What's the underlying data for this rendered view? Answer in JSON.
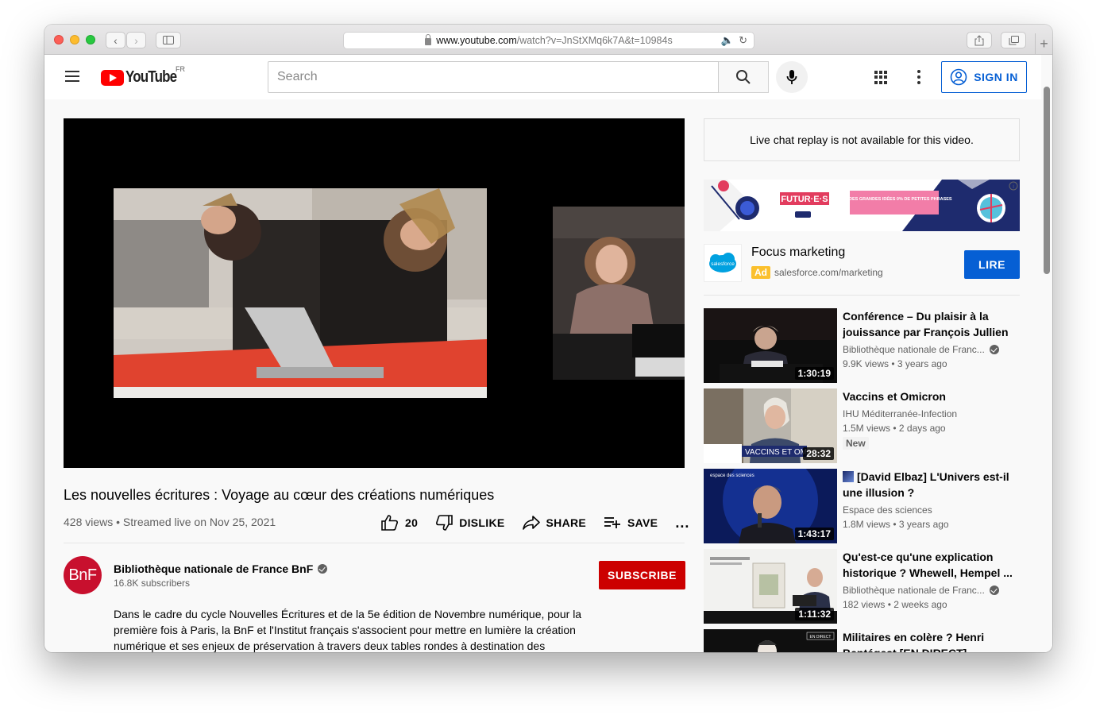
{
  "browser": {
    "url_host": "www.youtube.com",
    "url_path": "/watch?v=JnStXMq6k7A&t=10984s"
  },
  "header": {
    "logo_text": "YouTube",
    "region": "FR",
    "search_placeholder": "Search",
    "signin_label": "SIGN IN"
  },
  "video": {
    "title": "Les nouvelles écritures : Voyage au cœur des créations numériques",
    "meta": "428 views • Streamed live on Nov 25, 2021",
    "likes": "20",
    "dislike_label": "DISLIKE",
    "share_label": "SHARE",
    "save_label": "SAVE",
    "more_label": "..."
  },
  "channel": {
    "avatar_text": "BnF",
    "name": "Bibliothèque nationale de France BnF",
    "subscribers": "16.8K subscribers",
    "subscribe_label": "SUBSCRIBE",
    "description": "Dans le cadre du cycle Nouvelles Écritures et de la 5e édition de Novembre numérique, pour la première fois à Paris, la BnF et l'Institut français s'associent pour mettre en lumière la création numérique et ses enjeux de préservation à travers deux tables rondes à destination des"
  },
  "sidebar": {
    "chat_message": "Live chat replay is not available for this video.",
    "banner": {
      "brand": "FUTUR·E·S",
      "tagline": "100% DES GRANDES IDÉES 0% DE PETITES PHRASES"
    },
    "ad": {
      "logo_text": "salesforce",
      "title": "Focus marketing",
      "badge": "Ad",
      "url": "salesforce.com/marketing",
      "cta": "LIRE"
    },
    "recommendations": [
      {
        "title": "Conférence – Du plaisir à la jouissance par François Jullien",
        "channel": "Bibliothèque nationale de Franc...",
        "verified": true,
        "meta": "9.9K views • 3 years ago",
        "duration": "1:30:19",
        "badge": ""
      },
      {
        "title": "Vaccins et Omicron",
        "channel": "IHU Méditerranée-Infection",
        "verified": false,
        "meta": "1.5M views • 2 days ago",
        "duration": "28:32",
        "badge": "New",
        "thumb_caption": "VACCINS ET OM"
      },
      {
        "title": "[David Elbaz] L'Univers est-il une illusion ?",
        "channel": "Espace des sciences",
        "verified": false,
        "meta": "1.8M views • 3 years ago",
        "duration": "1:43:17",
        "badge": "",
        "thumb_caption": "espace des sciences"
      },
      {
        "title": "Qu'est-ce qu'une explication historique ? Whewell, Hempel ...",
        "channel": "Bibliothèque nationale de Franc...",
        "verified": true,
        "meta": "182 views • 2 weeks ago",
        "duration": "1:11:32",
        "badge": ""
      },
      {
        "title": "Militaires en colère ? Henri Bentégeat [EN DIRECT]",
        "channel": "",
        "verified": false,
        "meta": "",
        "duration": "",
        "badge": "",
        "thumb_caption": "EN DIRECT"
      }
    ]
  },
  "colors": {
    "youtube_red": "#ff0000",
    "subscribe_red": "#cc0000",
    "link_blue": "#065fd4",
    "bnf_red": "#c8102e",
    "ad_yellow": "#fbc02d"
  }
}
